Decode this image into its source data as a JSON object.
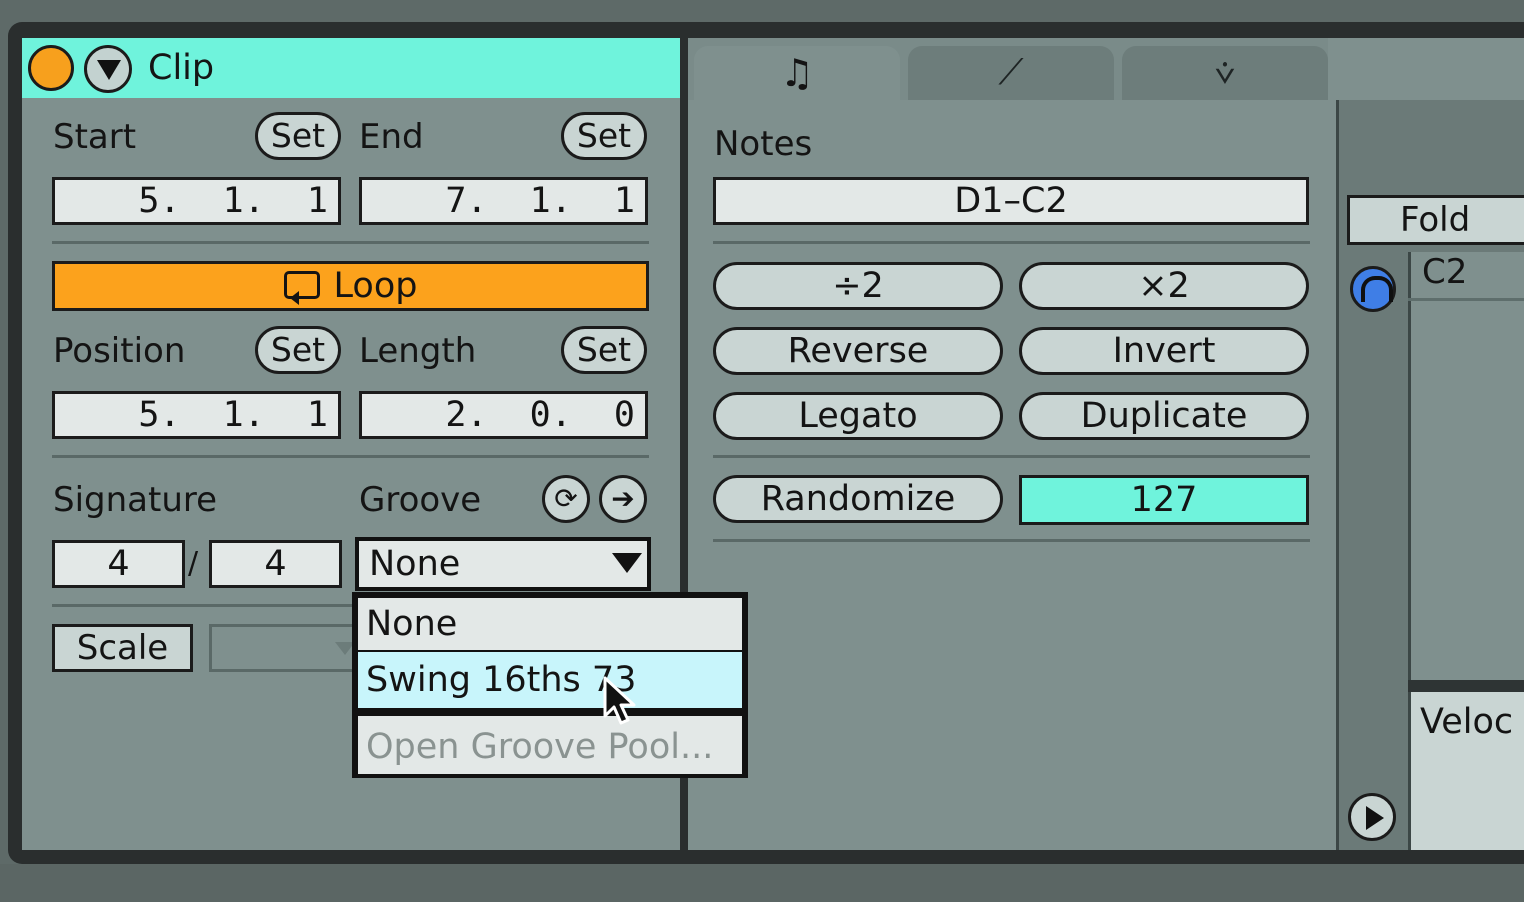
{
  "clip": {
    "title": "Clip",
    "start_label": "Start",
    "end_label": "End",
    "set_label": "Set",
    "start_value": "5.  1.  1",
    "end_value": "7.  1.  1",
    "loop_label": "Loop",
    "position_label": "Position",
    "length_label": "Length",
    "position_value": "5.  1.  1",
    "length_value": "2.  0.  0",
    "signature_label": "Signature",
    "signature_numerator": "4",
    "signature_slash": "/",
    "signature_denominator": "4",
    "groove_label": "Groove",
    "groove_selected": "None",
    "scale_label": "Scale"
  },
  "groove_dropdown": {
    "options": [
      "None",
      "Swing 16ths 73"
    ],
    "highlighted": "Swing 16ths 73",
    "open_pool": "Open Groove Pool..."
  },
  "notes": {
    "tabs": [
      {
        "icon": "note-icon",
        "glyph": "♫"
      },
      {
        "icon": "envelope-icon",
        "glyph": "⟋"
      },
      {
        "icon": "mpe-icon",
        "glyph": "⩒"
      }
    ],
    "title": "Notes",
    "range": "D1–C2",
    "half": "÷2",
    "double": "×2",
    "reverse": "Reverse",
    "invert": "Invert",
    "legato": "Legato",
    "duplicate": "Duplicate",
    "randomize": "Randomize",
    "randomize_value": "127"
  },
  "editor": {
    "fold": "Fold",
    "key_label": "C2",
    "velocity_label": "Veloc"
  },
  "colors": {
    "accent_cyan": "#6ff3dc",
    "loop_orange": "#fca21c",
    "headphone_blue": "#3f7ee6"
  }
}
